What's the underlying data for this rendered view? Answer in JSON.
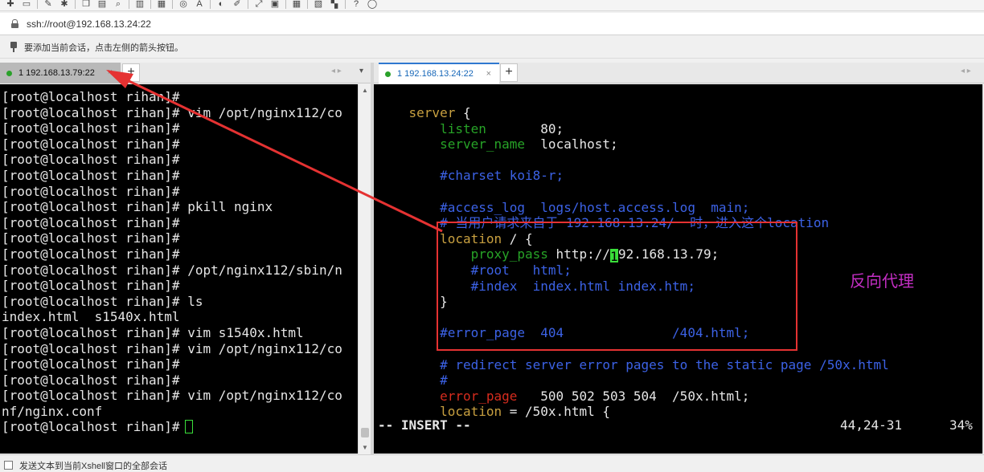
{
  "address": {
    "url": "ssh://root@192.168.13.24:22"
  },
  "hint": {
    "text": "要添加当前会话，点击左侧的箭头按钮。"
  },
  "tabs_left": {
    "active_label": "1 192.168.13.79:22",
    "close": "×",
    "add": "+",
    "nav": "◂ ▸",
    "menu": "▾"
  },
  "tabs_right": {
    "active_label": "1 192.168.13.24:22",
    "close": "×",
    "add": "+",
    "nav": "◂ ▸"
  },
  "toolbar": {
    "icons": [
      "new-session-icon",
      "open-folder-icon",
      "reconnect-icon",
      "settings-icon",
      "copy-icon",
      "paste-icon",
      "search-icon",
      "print-icon",
      "transfer-icon",
      "globe-icon",
      "font-icon",
      "color-icon",
      "script-icon",
      "fullscreen-icon",
      "lock-icon",
      "keyboard-icon",
      "compose-icon",
      "layout-icon",
      "help-icon",
      "chat-icon"
    ]
  },
  "left_terminal": {
    "lines": [
      "[root@localhost rihan]#",
      "[root@localhost rihan]# vim /opt/nginx112/co",
      "[root@localhost rihan]#",
      "[root@localhost rihan]#",
      "[root@localhost rihan]#",
      "[root@localhost rihan]#",
      "[root@localhost rihan]#",
      "[root@localhost rihan]# pkill nginx",
      "[root@localhost rihan]#",
      "[root@localhost rihan]#",
      "[root@localhost rihan]#",
      "[root@localhost rihan]# /opt/nginx112/sbin/n",
      "[root@localhost rihan]#",
      "[root@localhost rihan]# ls",
      "index.html  s1540x.html",
      "[root@localhost rihan]# vim s1540x.html",
      "[root@localhost rihan]# vim /opt/nginx112/co",
      "[root@localhost rihan]#",
      "[root@localhost rihan]#",
      "[root@localhost rihan]# vim /opt/nginx112/co",
      "nf/nginx.conf"
    ],
    "prompt_last": "[root@localhost rihan]#"
  },
  "right_terminal": {
    "l01_a": "    ",
    "l01_b": "server",
    "l01_c": " {",
    "l02_a": "        ",
    "l02_b": "listen",
    "l02_c": "       80;",
    "l03_a": "        ",
    "l03_b": "server_name",
    "l03_c": "  localhost;",
    "l05_a": "        ",
    "l05_b": "#charset koi8-r;",
    "l07_a": "        ",
    "l07_b": "#access_log  logs/host.access.log  main;",
    "l08_a": "        ",
    "l08_b": "# 当用户请求来自于 192.168.13.24/  时，进入这个location",
    "l09_a": "        ",
    "l09_b": "location",
    "l09_c": " / {",
    "l10_a": "            ",
    "l10_b": "proxy_pass",
    "l10_c": " http://",
    "l10_cur": "1",
    "l10_d": "92.168.13.79;",
    "l11_a": "            ",
    "l11_b": "#root   html;",
    "l12_a": "            ",
    "l12_b": "#index  index.html index.htm;",
    "l13_a": "        ",
    "l13_b": "}",
    "l15_a": "        ",
    "l15_b": "#error_page  404              /404.html;",
    "l17_a": "        ",
    "l17_b": "# redirect server error pages to the static page /50x.html",
    "l18_a": "        ",
    "l18_b": "#",
    "l19_a": "        ",
    "l19_b": "error_page",
    "l19_c": "   500 502 503 504  /50x.html;",
    "l20_a": "        ",
    "l20_b": "location",
    "l20_c": " = /50x.html {",
    "mode": "-- INSERT --",
    "position": "44,24-31",
    "percent": "34%"
  },
  "annotation": {
    "label": "反向代理"
  },
  "bottom": {
    "text": "发送文本到当前Xshell窗口的全部会话"
  },
  "colors": {
    "keyword": "#c8a040",
    "directive": "#27a327",
    "comment": "#3c62e6",
    "annotation_box": "#e53232",
    "annotation_text": "#c32ec3"
  }
}
